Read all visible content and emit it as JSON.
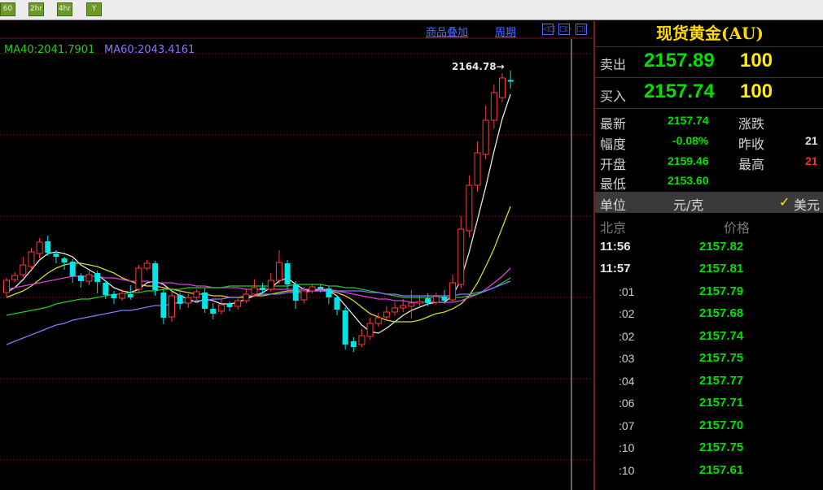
{
  "toolbar": {
    "buttons": [
      {
        "label": "60"
      },
      {
        "label": "2hr"
      },
      {
        "label": "4hr"
      },
      {
        "label": "Y"
      }
    ]
  },
  "chart_header": {
    "overlay_link": "商品叠加",
    "period_link": "周期",
    "nav_icons": [
      "◁▢",
      "▢▷",
      "▢|"
    ]
  },
  "ma_legend": {
    "ma40": "MA40:2041.7901",
    "ma60": "MA60:2043.4161",
    "ma40_color": "#22cc22",
    "ma60_color": "#8877ff"
  },
  "colors": {
    "up": "#ff3a3a",
    "down": "#00e5e5",
    "grid": "#7a1111",
    "quote_green": "#00e000",
    "volume_yellow": "#ffee00",
    "title_yellow": "#ffd800"
  },
  "chart_data": {
    "type": "candlestick",
    "high_marker": "2164.78→",
    "note": "no axes printed",
    "candles": [
      {
        "o": 2028.0,
        "c": 2035.5,
        "h": 2037.0,
        "l": 2025.0
      },
      {
        "o": 2036.0,
        "c": 2038.5,
        "h": 2040.5,
        "l": 2034.5
      },
      {
        "o": 2039.0,
        "c": 2045.0,
        "h": 2050.0,
        "l": 2037.5
      },
      {
        "o": 2044.0,
        "c": 2053.0,
        "h": 2055.5,
        "l": 2042.0
      },
      {
        "o": 2052.0,
        "c": 2059.0,
        "h": 2061.5,
        "l": 2049.0
      },
      {
        "o": 2059.5,
        "c": 2052.5,
        "h": 2063.0,
        "l": 2050.5
      },
      {
        "o": 2052.0,
        "c": 2050.0,
        "h": 2054.0,
        "l": 2046.0
      },
      {
        "o": 2049.0,
        "c": 2046.5,
        "h": 2050.0,
        "l": 2042.0
      },
      {
        "o": 2047.0,
        "c": 2038.0,
        "h": 2048.5,
        "l": 2034.0
      },
      {
        "o": 2038.5,
        "c": 2035.0,
        "h": 2040.0,
        "l": 2031.0
      },
      {
        "o": 2035.0,
        "c": 2039.0,
        "h": 2042.0,
        "l": 2032.5
      },
      {
        "o": 2040.0,
        "c": 2034.5,
        "h": 2041.5,
        "l": 2027.5
      },
      {
        "o": 2034.0,
        "c": 2026.5,
        "h": 2035.0,
        "l": 2024.0
      },
      {
        "o": 2027.0,
        "c": 2024.5,
        "h": 2029.0,
        "l": 2021.0
      },
      {
        "o": 2024.5,
        "c": 2027.5,
        "h": 2030.0,
        "l": 2023.0
      },
      {
        "o": 2027.0,
        "c": 2025.0,
        "h": 2032.5,
        "l": 2023.5
      },
      {
        "o": 2030.0,
        "c": 2043.0,
        "h": 2045.0,
        "l": 2028.5
      },
      {
        "o": 2043.0,
        "c": 2046.0,
        "h": 2048.0,
        "l": 2041.5
      },
      {
        "o": 2046.0,
        "c": 2029.5,
        "h": 2047.5,
        "l": 2026.0
      },
      {
        "o": 2028.0,
        "c": 2012.5,
        "h": 2030.0,
        "l": 2008.5
      },
      {
        "o": 2013.0,
        "c": 2026.0,
        "h": 2028.5,
        "l": 2010.0
      },
      {
        "o": 2026.5,
        "c": 2021.0,
        "h": 2028.0,
        "l": 2017.5
      },
      {
        "o": 2021.5,
        "c": 2025.0,
        "h": 2027.0,
        "l": 2018.5
      },
      {
        "o": 2025.0,
        "c": 2028.5,
        "h": 2030.0,
        "l": 2022.0
      },
      {
        "o": 2028.0,
        "c": 2018.0,
        "h": 2030.5,
        "l": 2015.5
      },
      {
        "o": 2018.0,
        "c": 2015.0,
        "h": 2021.5,
        "l": 2011.5
      },
      {
        "o": 2016.5,
        "c": 2020.5,
        "h": 2023.5,
        "l": 2014.5
      },
      {
        "o": 2021.0,
        "c": 2019.0,
        "h": 2022.5,
        "l": 2016.5
      },
      {
        "o": 2019.5,
        "c": 2023.0,
        "h": 2025.0,
        "l": 2017.5
      },
      {
        "o": 2023.0,
        "c": 2027.0,
        "h": 2030.5,
        "l": 2021.5
      },
      {
        "o": 2027.0,
        "c": 2031.0,
        "h": 2036.0,
        "l": 2025.5
      },
      {
        "o": 2031.0,
        "c": 2029.5,
        "h": 2034.0,
        "l": 2027.0
      },
      {
        "o": 2030.0,
        "c": 2035.5,
        "h": 2040.0,
        "l": 2028.5
      },
      {
        "o": 2035.5,
        "c": 2046.5,
        "h": 2054.0,
        "l": 2033.5
      },
      {
        "o": 2046.0,
        "c": 2033.0,
        "h": 2048.0,
        "l": 2030.0
      },
      {
        "o": 2033.0,
        "c": 2023.0,
        "h": 2035.0,
        "l": 2018.0
      },
      {
        "o": 2023.5,
        "c": 2029.0,
        "h": 2031.5,
        "l": 2021.5
      },
      {
        "o": 2029.0,
        "c": 2031.5,
        "h": 2033.5,
        "l": 2027.5
      },
      {
        "o": 2031.5,
        "c": 2030.0,
        "h": 2033.0,
        "l": 2028.0
      },
      {
        "o": 2030.5,
        "c": 2025.0,
        "h": 2032.0,
        "l": 2021.0
      },
      {
        "o": 2025.0,
        "c": 2017.5,
        "h": 2026.5,
        "l": 2014.0
      },
      {
        "o": 2017.0,
        "c": 1996.0,
        "h": 2019.0,
        "l": 1993.0
      },
      {
        "o": 1998.0,
        "c": 1994.5,
        "h": 2000.5,
        "l": 1991.5
      },
      {
        "o": 1996.0,
        "c": 2001.5,
        "h": 2005.5,
        "l": 1994.5
      },
      {
        "o": 2001.0,
        "c": 2009.0,
        "h": 2012.5,
        "l": 1999.0
      },
      {
        "o": 2009.0,
        "c": 2012.5,
        "h": 2015.5,
        "l": 2007.0
      },
      {
        "o": 2013.0,
        "c": 2016.0,
        "h": 2019.5,
        "l": 2011.5
      },
      {
        "o": 2016.0,
        "c": 2018.5,
        "h": 2022.0,
        "l": 2013.5
      },
      {
        "o": 2018.5,
        "c": 2020.0,
        "h": 2024.0,
        "l": 2016.0
      },
      {
        "o": 2019.5,
        "c": 2021.5,
        "h": 2029.5,
        "l": 2012.0
      },
      {
        "o": 2021.5,
        "c": 2022.5,
        "h": 2026.5,
        "l": 2019.0
      },
      {
        "o": 2024.5,
        "c": 2021.5,
        "h": 2027.5,
        "l": 2019.5
      },
      {
        "o": 2022.0,
        "c": 2025.5,
        "h": 2028.0,
        "l": 2020.5
      },
      {
        "o": 2025.5,
        "c": 2023.0,
        "h": 2029.5,
        "l": 2021.0
      },
      {
        "o": 2023.5,
        "c": 2034.0,
        "h": 2039.0,
        "l": 2022.0
      },
      {
        "o": 2033.0,
        "c": 2067.0,
        "h": 2075.0,
        "l": 2030.5
      },
      {
        "o": 2066.0,
        "c": 2094.0,
        "h": 2100.0,
        "l": 2062.0
      },
      {
        "o": 2094.0,
        "c": 2114.0,
        "h": 2121.0,
        "l": 2090.0
      },
      {
        "o": 2113.0,
        "c": 2134.0,
        "h": 2143.0,
        "l": 2110.0
      },
      {
        "o": 2134.0,
        "c": 2151.0,
        "h": 2156.0,
        "l": 2129.0
      },
      {
        "o": 2148.0,
        "c": 2160.0,
        "h": 2163.0,
        "l": 2145.0
      },
      {
        "o": 2158.8,
        "c": 2157.74,
        "h": 2164.78,
        "l": 2153.6
      }
    ],
    "series": [
      {
        "color": "#e8e8e8",
        "values": [
          2028,
          2031,
          2036,
          2042,
          2048,
          2052,
          2053,
          2052,
          2050,
          2045,
          2042,
          2039,
          2035,
          2031,
          2029,
          2028,
          2030,
          2034,
          2035,
          2033,
          2029,
          2026,
          2024,
          2022,
          2024,
          2023,
          2021,
          2021,
          2022,
          2024,
          2026,
          2028,
          2031,
          2035,
          2037,
          2033,
          2030,
          2029,
          2030,
          2029,
          2026,
          2020,
          2014,
          2008,
          2004,
          2003,
          2006,
          2010,
          2014,
          2017,
          2019,
          2021,
          2022,
          2022,
          2026,
          2036,
          2053,
          2073,
          2093,
          2115,
          2135,
          2150
        ]
      },
      {
        "color": "#d8d82a",
        "values": [
          2025,
          2027,
          2029,
          2032,
          2036,
          2040,
          2043,
          2045,
          2046,
          2046,
          2045,
          2044,
          2042,
          2040,
          2037,
          2035,
          2033,
          2032,
          2032,
          2031,
          2030,
          2029,
          2028,
          2027,
          2027,
          2026,
          2026,
          2025,
          2025,
          2025,
          2026,
          2026,
          2027,
          2028,
          2029,
          2029,
          2029,
          2029,
          2029,
          2029,
          2028,
          2026,
          2023,
          2019,
          2015,
          2013,
          2011,
          2010,
          2010,
          2010,
          2011,
          2013,
          2015,
          2016,
          2018,
          2021,
          2026,
          2034,
          2044,
          2055,
          2068,
          2081
        ]
      },
      {
        "color": "#e040e0",
        "values": [
          2030,
          2031,
          2032,
          2033,
          2034,
          2035,
          2036,
          2037,
          2038,
          2038,
          2038,
          2038,
          2037,
          2037,
          2036,
          2035,
          2035,
          2035,
          2034,
          2034,
          2034,
          2033,
          2033,
          2032,
          2032,
          2031,
          2031,
          2031,
          2031,
          2030,
          2030,
          2030,
          2030,
          2030,
          2030,
          2030,
          2030,
          2030,
          2030,
          2030,
          2029,
          2028,
          2027,
          2026,
          2025,
          2024,
          2024,
          2023,
          2023,
          2022,
          2022,
          2022,
          2022,
          2022,
          2022,
          2023,
          2025,
          2027,
          2030,
          2034,
          2038,
          2043
        ]
      },
      {
        "color": "#22cc22",
        "values": [
          2014,
          2015,
          2016,
          2017,
          2018,
          2019,
          2021,
          2022,
          2023,
          2024,
          2024,
          2025,
          2026,
          2027,
          2027,
          2028,
          2028,
          2029,
          2029,
          2030,
          2030,
          2030,
          2031,
          2031,
          2031,
          2031,
          2031,
          2032,
          2032,
          2032,
          2032,
          2032,
          2032,
          2032,
          2032,
          2033,
          2033,
          2033,
          2033,
          2032,
          2032,
          2031,
          2031,
          2030,
          2029,
          2028,
          2027,
          2026,
          2025,
          2025,
          2025,
          2025,
          2025,
          2025,
          2025,
          2025,
          2026,
          2027,
          2029,
          2031,
          2034,
          2037
        ]
      },
      {
        "color": "#8877ff",
        "values": [
          1996,
          1998,
          2000,
          2002,
          2004,
          2006,
          2008,
          2009,
          2011,
          2012,
          2013,
          2014,
          2015,
          2016,
          2017,
          2017,
          2018,
          2019,
          2020,
          2020,
          2021,
          2022,
          2022,
          2023,
          2023,
          2024,
          2024,
          2025,
          2025,
          2026,
          2026,
          2027,
          2027,
          2027,
          2028,
          2028,
          2028,
          2029,
          2029,
          2029,
          2029,
          2029,
          2029,
          2029,
          2028,
          2028,
          2027,
          2027,
          2026,
          2026,
          2026,
          2026,
          2026,
          2026,
          2026,
          2027,
          2027,
          2028,
          2029,
          2031,
          2033,
          2035
        ]
      }
    ]
  },
  "quote": {
    "instrument": "现货黄金(AU)",
    "sell_label": "卖出",
    "sell_price": "2157.89",
    "sell_vol": "100",
    "buy_label": "买入",
    "buy_price": "2157.74",
    "buy_vol": "100",
    "stats": [
      {
        "label": "最新",
        "value": "2157.74"
      },
      {
        "label": "幅度",
        "value": "-0.08%"
      },
      {
        "label": "开盘",
        "value": "2159.46"
      },
      {
        "label": "最低",
        "value": "2153.60"
      }
    ],
    "stats_right": [
      {
        "label": "涨跌",
        "value": ""
      },
      {
        "label": "昨收",
        "value": "21"
      },
      {
        "label": "最高",
        "value": "21"
      }
    ],
    "unit_label": "单位",
    "unit_value": "元/克",
    "currency_check": "✓",
    "currency": "美元"
  },
  "ticks": {
    "time_header": "北京",
    "price_header": "价格",
    "rows": [
      {
        "time": "11:56",
        "price": "2157.82"
      },
      {
        "time": "11:57",
        "price": "2157.81"
      },
      {
        "time": ":01",
        "price": "2157.79"
      },
      {
        "time": ":02",
        "price": "2157.68"
      },
      {
        "time": ":02",
        "price": "2157.74"
      },
      {
        "time": ":03",
        "price": "2157.75"
      },
      {
        "time": ":04",
        "price": "2157.77"
      },
      {
        "time": ":06",
        "price": "2157.71"
      },
      {
        "time": ":07",
        "price": "2157.70"
      },
      {
        "time": ":10",
        "price": "2157.75"
      },
      {
        "time": ":10",
        "price": "2157.61"
      }
    ]
  }
}
